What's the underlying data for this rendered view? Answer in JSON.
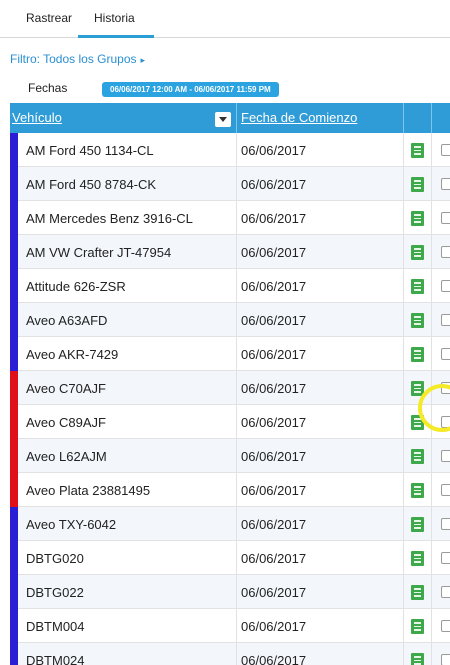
{
  "tabs": [
    {
      "label": "Rastrear"
    },
    {
      "label": "Historia"
    }
  ],
  "filter": {
    "label": "Filtro: Todos los Grupos",
    "caret": "▸"
  },
  "dates": {
    "label": "Fechas",
    "range": "06/06/2017 12:00 AM - 06/06/2017 11:59 PM"
  },
  "table": {
    "columns": {
      "vehicle": "Vehículo",
      "start_date": "Fecha de Comienzo"
    },
    "rows": [
      {
        "vehicle": "AM Ford 450 1134-CL",
        "date": "06/06/2017",
        "bar_color": "#2b1fd6"
      },
      {
        "vehicle": "AM Ford 450 8784-CK",
        "date": "06/06/2017",
        "bar_color": "#2b1fd6"
      },
      {
        "vehicle": "AM Mercedes Benz 3916-CL",
        "date": "06/06/2017",
        "bar_color": "#2b1fd6"
      },
      {
        "vehicle": "AM VW Crafter JT-47954",
        "date": "06/06/2017",
        "bar_color": "#2b1fd6"
      },
      {
        "vehicle": "Attitude 626-ZSR",
        "date": "06/06/2017",
        "bar_color": "#2b1fd6"
      },
      {
        "vehicle": "Aveo A63AFD",
        "date": "06/06/2017",
        "bar_color": "#2b1fd6"
      },
      {
        "vehicle": "Aveo AKR-7429",
        "date": "06/06/2017",
        "bar_color": "#2b1fd6"
      },
      {
        "vehicle": "Aveo C70AJF",
        "date": "06/06/2017",
        "bar_color": "#e0101a"
      },
      {
        "vehicle": "Aveo C89AJF",
        "date": "06/06/2017",
        "bar_color": "#e0101a"
      },
      {
        "vehicle": "Aveo L62AJM",
        "date": "06/06/2017",
        "bar_color": "#e0101a"
      },
      {
        "vehicle": "Aveo Plata 23881495",
        "date": "06/06/2017",
        "bar_color": "#e0101a"
      },
      {
        "vehicle": "Aveo TXY-6042",
        "date": "06/06/2017",
        "bar_color": "#2b1fd6"
      },
      {
        "vehicle": "DBTG020",
        "date": "06/06/2017",
        "bar_color": "#2b1fd6"
      },
      {
        "vehicle": "DBTG022",
        "date": "06/06/2017",
        "bar_color": "#2b1fd6"
      },
      {
        "vehicle": "DBTM004",
        "date": "06/06/2017",
        "bar_color": "#2b1fd6"
      },
      {
        "vehicle": "DBTM024",
        "date": "06/06/2017",
        "bar_color": "#2b1fd6"
      }
    ]
  },
  "colors": {
    "accent": "#2f9bd7",
    "report_icon": "#3ea94a",
    "cursor_highlight": "#f4ea27"
  },
  "icons": {
    "report": "report-document-icon",
    "dropdown": "chevron-down-icon",
    "filter_caret": "caret-right-icon"
  }
}
